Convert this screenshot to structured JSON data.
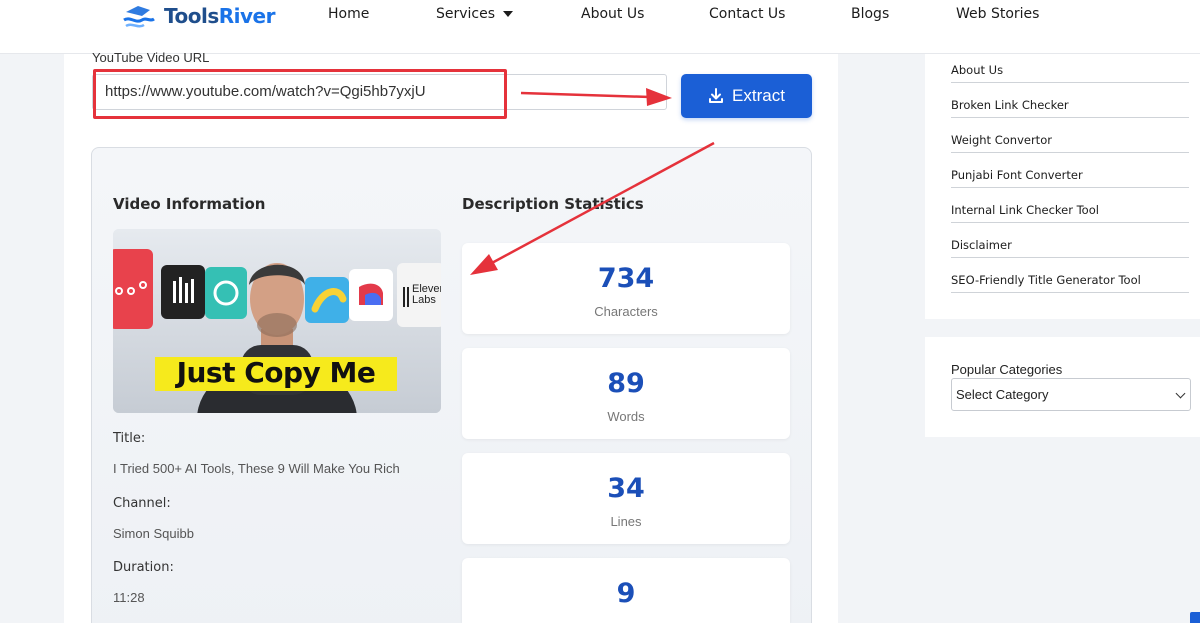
{
  "header": {
    "logo_text_a": "Tools",
    "logo_text_b": "River",
    "nav": [
      {
        "label": "Home"
      },
      {
        "label": "Services"
      },
      {
        "label": "About Us"
      },
      {
        "label": "Contact Us"
      },
      {
        "label": "Blogs"
      },
      {
        "label": "Web Stories"
      }
    ]
  },
  "form": {
    "url_label": "YouTube Video URL",
    "url_value": "https://www.youtube.com/watch?v=Qgi5hb7yxjU",
    "extract_label": "Extract"
  },
  "video_info": {
    "heading": "Video Information",
    "thumbnail_caption": "Just Copy Me",
    "thumbnail_badge": "Eleven Labs",
    "title_label": "Title:",
    "title_value": "I Tried 500+ AI Tools, These 9 Will Make You Rich",
    "channel_label": "Channel:",
    "channel_value": "Simon Squibb",
    "duration_label": "Duration:",
    "duration_value": "11:28"
  },
  "stats": {
    "heading": "Description Statistics",
    "items": [
      {
        "value": "734",
        "label": "Characters"
      },
      {
        "value": "89",
        "label": "Words"
      },
      {
        "value": "34",
        "label": "Lines"
      },
      {
        "value": "9",
        "label": ""
      }
    ]
  },
  "sidebar": {
    "links": [
      {
        "label": "About Us"
      },
      {
        "label": "Broken Link Checker"
      },
      {
        "label": "Weight Convertor"
      },
      {
        "label": "Punjabi Font Converter"
      },
      {
        "label": "Internal Link Checker Tool"
      },
      {
        "label": "Disclaimer"
      },
      {
        "label": "SEO-Friendly Title Generator Tool"
      }
    ],
    "categories_title": "Popular Categories",
    "categories_selected": "Select Category"
  },
  "colors": {
    "accent": "#1b5fd6",
    "highlight": "#e5323b",
    "stat_number": "#1b4fb8"
  }
}
